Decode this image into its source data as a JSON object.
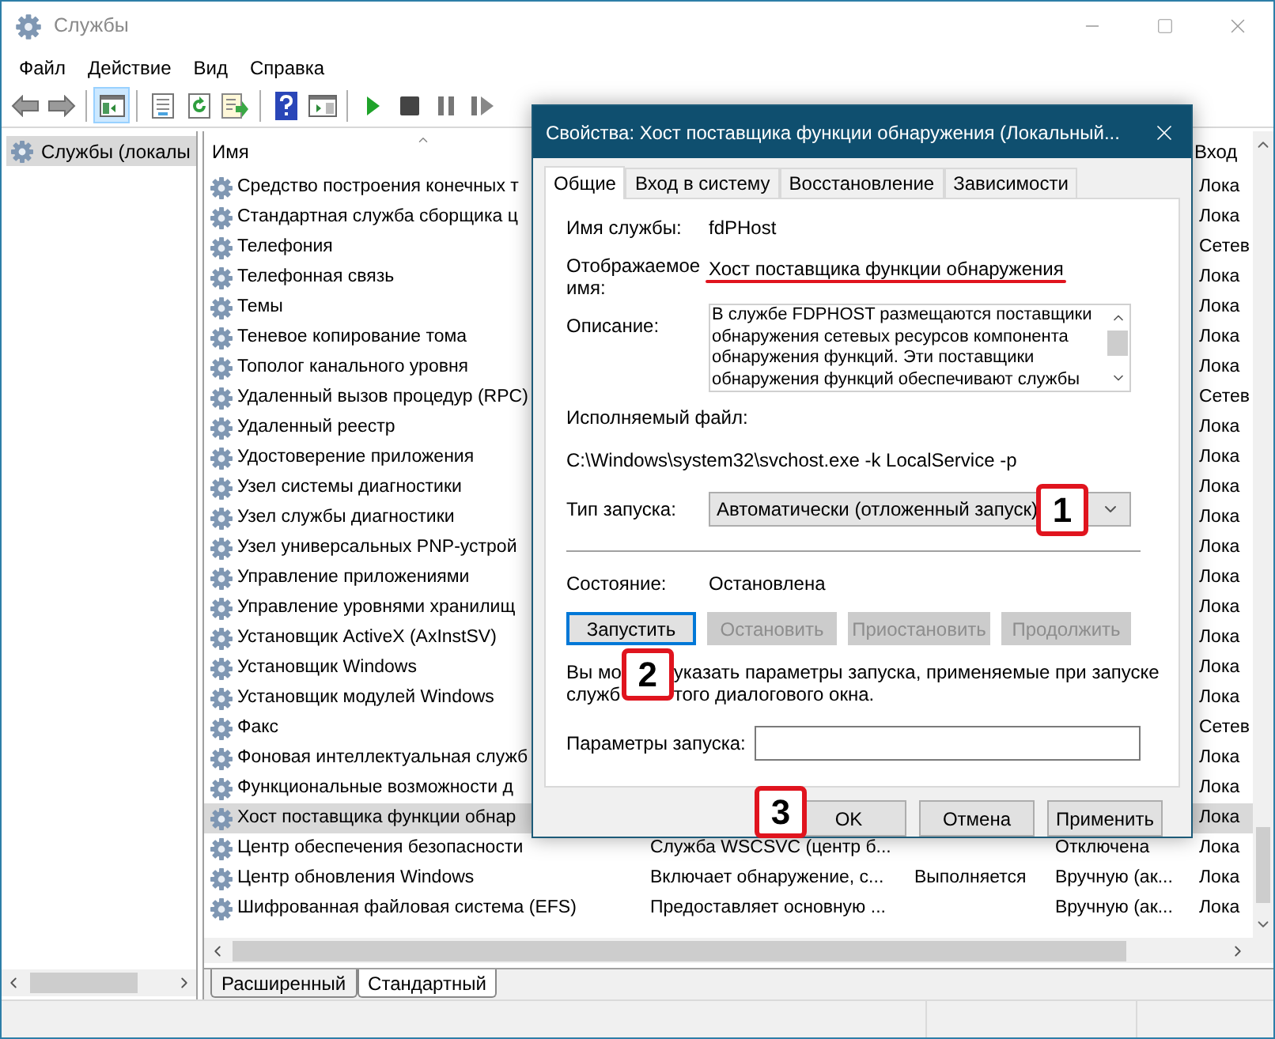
{
  "window": {
    "title": "Службы"
  },
  "menu": [
    "Файл",
    "Действие",
    "Вид",
    "Справка"
  ],
  "toolbar": {
    "groups": [
      [
        {
          "kind": "back",
          "pressed": false
        },
        {
          "kind": "forward",
          "pressed": false
        }
      ],
      [
        {
          "kind": "tree",
          "pressed": true
        }
      ],
      [
        {
          "kind": "properties",
          "pressed": false
        },
        {
          "kind": "refresh",
          "pressed": false
        },
        {
          "kind": "export",
          "pressed": false
        }
      ],
      [
        {
          "kind": "help",
          "pressed": false
        },
        {
          "kind": "action-pane",
          "pressed": false
        }
      ],
      [
        {
          "kind": "start",
          "pressed": false
        },
        {
          "kind": "stop",
          "pressed": false
        },
        {
          "kind": "pause",
          "pressed": false
        },
        {
          "kind": "resume",
          "pressed": false
        }
      ]
    ]
  },
  "tree": [
    {
      "label": "Службы (локалы",
      "selected": true
    }
  ],
  "table": {
    "columns": [
      "Имя",
      "Вход"
    ],
    "rows": [
      {
        "name": "Средство построения конечных т",
        "logon": "Лока",
        "selected": false
      },
      {
        "name": "Стандартная служба сборщика ц",
        "logon": "Лока",
        "selected": false
      },
      {
        "name": "Телефония",
        "logon": "Сетев",
        "selected": false
      },
      {
        "name": "Телефонная связь",
        "logon": "Лока",
        "selected": false
      },
      {
        "name": "Темы",
        "logon": "Лока",
        "selected": false
      },
      {
        "name": "Теневое копирование тома",
        "logon": "Лока",
        "selected": false
      },
      {
        "name": "Тополог канального уровня",
        "logon": "Лока",
        "selected": false
      },
      {
        "name": "Удаленный вызов процедур (RPC)",
        "logon": "Сетев",
        "selected": false
      },
      {
        "name": "Удаленный реестр",
        "logon": "Лока",
        "selected": false
      },
      {
        "name": "Удостоверение приложения",
        "logon": "Лока",
        "selected": false
      },
      {
        "name": "Узел системы диагностики",
        "logon": "Лока",
        "selected": false
      },
      {
        "name": "Узел службы диагностики",
        "logon": "Лока",
        "selected": false
      },
      {
        "name": "Узел универсальных PNP-устрой",
        "logon": "Лока",
        "selected": false
      },
      {
        "name": "Управление приложениями",
        "logon": "Лока",
        "selected": false
      },
      {
        "name": "Управление уровнями хранилищ",
        "logon": "Лока",
        "selected": false
      },
      {
        "name": "Установщик ActiveX (AxInstSV)",
        "logon": "Лока",
        "selected": false
      },
      {
        "name": "Установщик Windows",
        "logon": "Лока",
        "selected": false
      },
      {
        "name": "Установщик модулей Windows",
        "logon": "Лока",
        "selected": false
      },
      {
        "name": "Факс",
        "logon": "Сетев",
        "selected": false
      },
      {
        "name": "Фоновая интеллектуальная служб",
        "logon": "Лока",
        "selected": false
      },
      {
        "name": "Функциональные возможности д",
        "logon": "Лока",
        "selected": false
      },
      {
        "name": "Хост поставщика функции обнар",
        "logon": "Лока",
        "selected": true
      },
      {
        "name": "Центр обеспечения безопасности",
        "description": "Служба WSCSVC (центр б...",
        "startup": "Отключена",
        "logon": "Лока",
        "selected": false
      },
      {
        "name": "Центр обновления Windows",
        "description": "Включает обнаружение, с...",
        "status": "Выполняется",
        "startup": "Вручную (ак...",
        "logon": "Лока",
        "selected": false
      },
      {
        "name": "Шифрованная файловая система (EFS)",
        "description": "Предоставляет основную ...",
        "startup": "Вручную (ак...",
        "logon": "Лока",
        "selected": false
      }
    ]
  },
  "view_tabs": [
    {
      "label": "Расширенный",
      "selected": false
    },
    {
      "label": "Стандартный",
      "selected": true
    }
  ],
  "dialog": {
    "title": "Свойства: Хост поставщика функции обнаружения (Локальный...",
    "tabs": [
      {
        "label": "Общие",
        "selected": true
      },
      {
        "label": "Вход в систему",
        "selected": false
      },
      {
        "label": "Восстановление",
        "selected": false
      },
      {
        "label": "Зависимости",
        "selected": false
      }
    ],
    "service_name_label": "Имя службы:",
    "service_name": "fdPHost",
    "display_name_label": "Отображаемое имя:",
    "display_name": "Хост поставщика функции обнаружения",
    "description_label": "Описание:",
    "description_lines": [
      "В службе FDPHOST размещаются поставщики",
      "обнаружения сетевых ресурсов компонента",
      "обнаружения функций. Эти поставщики",
      "обнаружения функций обеспечивают службы"
    ],
    "executable_label": "Исполняемый файл:",
    "executable": "C:\\Windows\\system32\\svchost.exe -k LocalService -p",
    "startup_type_label": "Тип запуска:",
    "startup_type": "Автоматически (отложенный запуск)",
    "status_label": "Состояние:",
    "status": "Остановлена",
    "service_buttons": [
      {
        "label": "Запустить",
        "disabled": false,
        "focused": true
      },
      {
        "label": "Остановить",
        "disabled": true,
        "focused": false
      },
      {
        "label": "Приостановить",
        "disabled": true,
        "focused": false
      },
      {
        "label": "Продолжить",
        "disabled": true,
        "focused": false
      }
    ],
    "hint_parts": [
      [
        "Вы мо",
        "указать параметры запуска, применяемые при запуске"
      ],
      [
        "служб",
        "того диалогового окна."
      ]
    ],
    "params_label": "Параметры запуска:",
    "footer_buttons": [
      "OK",
      "Отмена",
      "Применить"
    ]
  },
  "annotations": [
    {
      "label": "1"
    },
    {
      "label": "2"
    },
    {
      "label": "3"
    }
  ]
}
